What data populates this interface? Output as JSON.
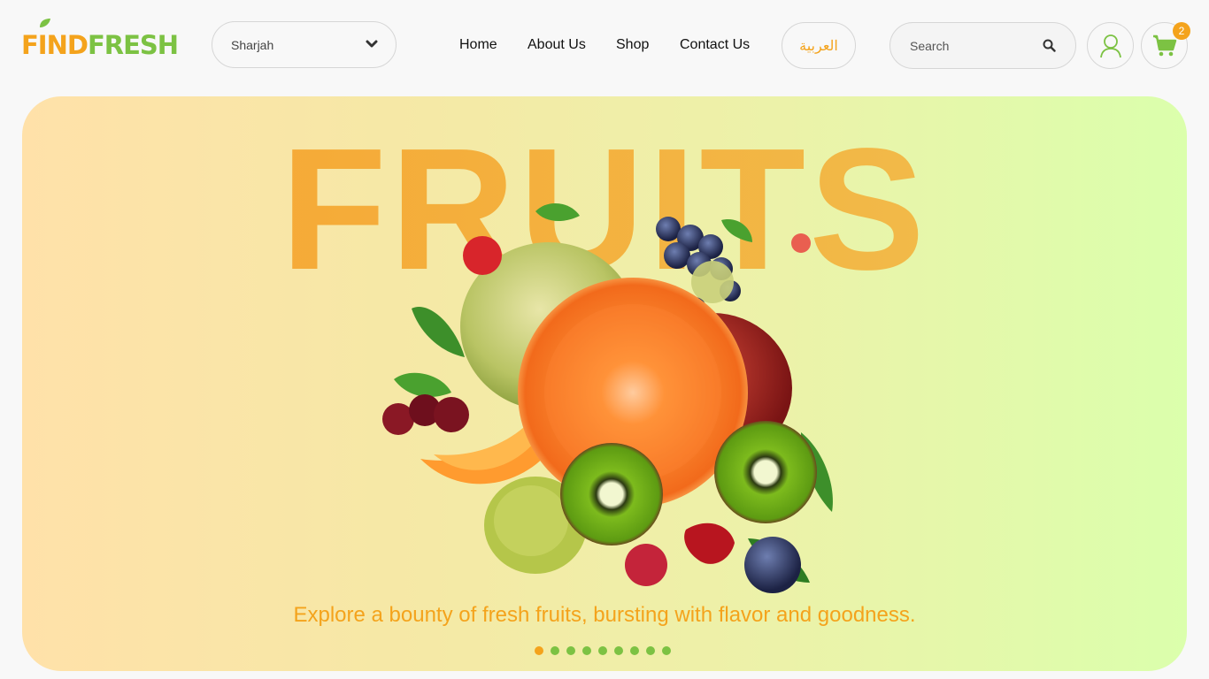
{
  "brand": {
    "find": "FIND",
    "fresh": "FRESH",
    "colors": {
      "orange": "#f4a31c",
      "green": "#7cc243"
    }
  },
  "location": {
    "selected": "Sharjah"
  },
  "nav": {
    "home": "Home",
    "about": "About Us",
    "shop": "Shop",
    "contact": "Contact Us"
  },
  "language": {
    "label": "العربية"
  },
  "search": {
    "placeholder": "Search"
  },
  "cart": {
    "count": "2"
  },
  "hero": {
    "title": "FRUITS",
    "tagline": "Explore a bounty of fresh fruits, bursting with flavor and goodness.",
    "slides": 9,
    "active_slide": 1
  },
  "icons": [
    "leaf-icon",
    "chevron-down-icon",
    "search-icon",
    "user-icon",
    "cart-icon"
  ]
}
